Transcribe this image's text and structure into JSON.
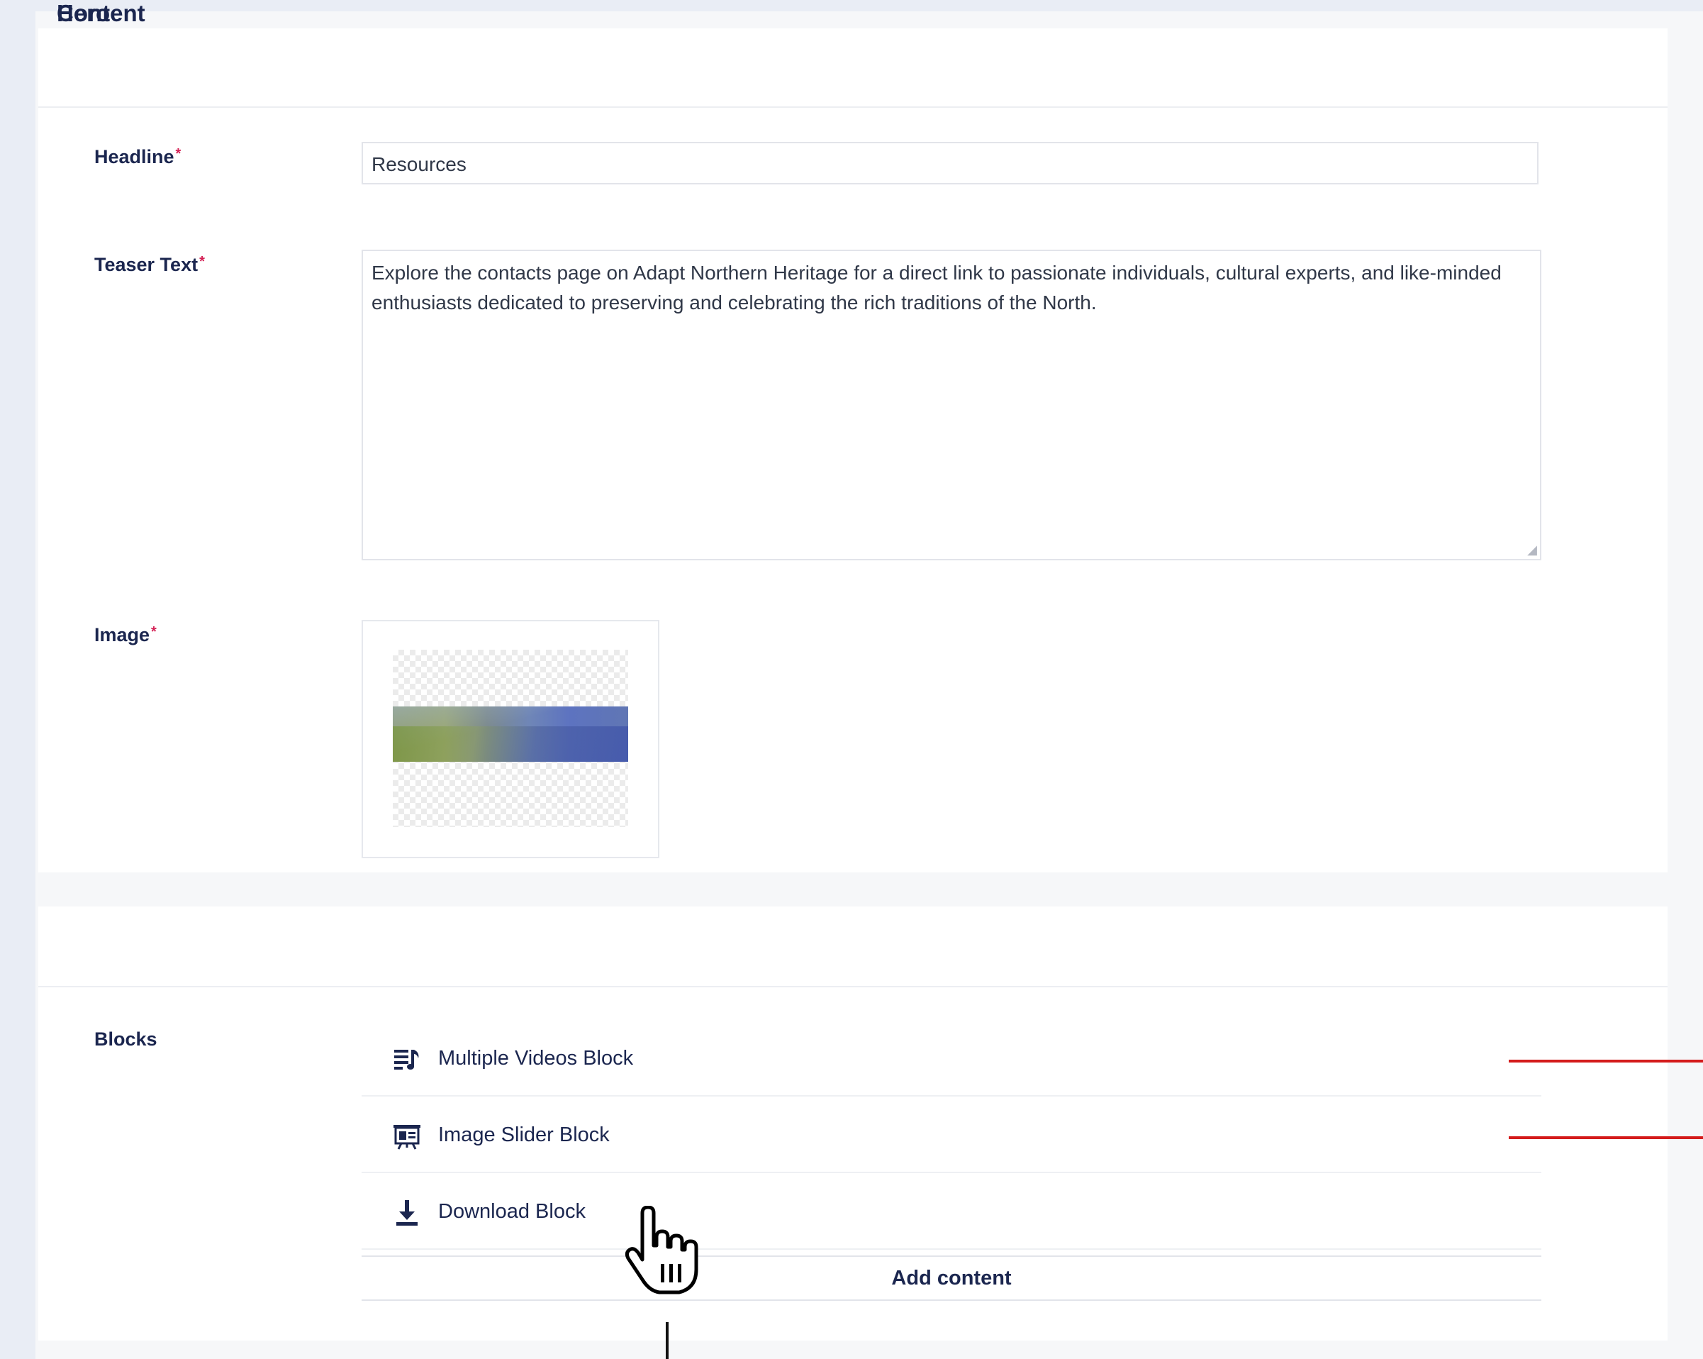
{
  "hero": {
    "title": "Hero",
    "headline": {
      "label": "Headline",
      "required_mark": "*",
      "value": "Resources"
    },
    "teaser": {
      "label": "Teaser Text",
      "required_mark": "*",
      "value": "Explore the contacts page on Adapt Northern Heritage for a direct link to passionate individuals, cultural experts, and like-minded enthusiasts dedicated to preserving and celebrating the rich traditions of the North."
    },
    "image": {
      "label": "Image",
      "required_mark": "*"
    }
  },
  "content": {
    "title": "Content",
    "blocks": {
      "label": "Blocks",
      "items": [
        {
          "label": "Multiple Videos Block",
          "icon": "video-playlist-icon"
        },
        {
          "label": "Image Slider Block",
          "icon": "image-slider-icon"
        },
        {
          "label": "Download Block",
          "icon": "download-icon"
        }
      ],
      "add_label": "Add content"
    }
  },
  "colors": {
    "required": "#d42054",
    "text": "#1b264f",
    "annotation_line": "#d41b1b"
  }
}
